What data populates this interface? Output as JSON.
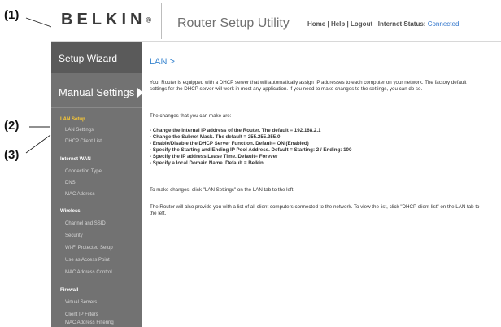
{
  "callouts": [
    "(1)",
    "(2)",
    "(3)"
  ],
  "header": {
    "logo": "BELKIN",
    "logo_mark": "®",
    "title": "Router Setup Utility",
    "nav": {
      "home": "Home",
      "help": "Help",
      "logout": "Logout",
      "sep": "|",
      "status_label": "Internet Status:",
      "status_value": "Connected"
    },
    "colors": {
      "status": "#3377cc"
    }
  },
  "sidebar": {
    "wizard": "Setup Wizard",
    "manual": "Manual Settings",
    "sections": [
      {
        "heading": "LAN Setup",
        "items": [
          "LAN Settings",
          "DHCP Client List"
        ]
      },
      {
        "heading": "Internet WAN",
        "items": [
          "Connection Type",
          "DNS",
          "MAC Address"
        ]
      },
      {
        "heading": "Wireless",
        "items": [
          "Channel and SSID",
          "Security",
          "Wi-Fi Protected Setup",
          "Use as Access Point",
          "MAC Address Control"
        ]
      },
      {
        "heading": "Firewall",
        "items": [
          "Virtual Servers",
          "Client IP Filters",
          "MAC Address Filtering"
        ]
      }
    ],
    "colors": {
      "active_heading": "#ffcc33"
    }
  },
  "main": {
    "breadcrumb": "LAN >",
    "intro": "Your Router is equipped with a DHCP server that will automatically assign IP addresses to each computer on your network. The factory default settings for the DHCP server will work in most any application. If you need to make changes to the settings, you can do so.",
    "changes_intro": "The changes that you can make are:",
    "changes": [
      "- Change the Internal IP address of the Router. The default = 192.168.2.1",
      "- Change the Subnet Mask. The default = 255.255.255.0",
      "- Enable/Disable the DHCP Server Function. Default= ON (Enabled)",
      "- Specify the Starting and Ending IP Pool Address. Default = Starting: 2 / Ending: 100",
      "- Specify the IP address Lease Time. Default= Forever",
      "- Specify a local Domain Name. Default = Belkin"
    ],
    "to_change": "To make changes, click \"LAN Settings\" on the LAN tab to the left.",
    "client_list": "The Router will also provide you with a list of all client computers connected to the network. To view the list, click \"DHCP client list\" on the LAN tab to the left."
  }
}
